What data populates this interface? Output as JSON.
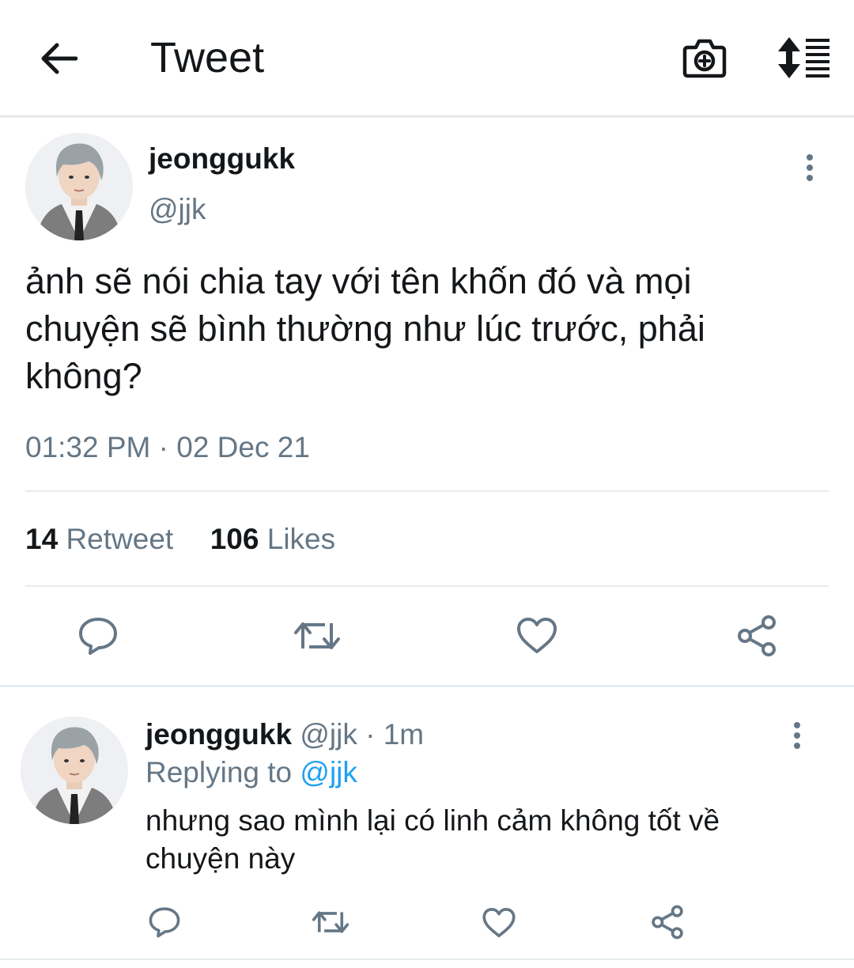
{
  "header": {
    "title": "Tweet",
    "back_icon": "arrow-left-icon",
    "camera_icon": "camera-plus-icon",
    "sort_icon": "sort-lines-icon"
  },
  "tweet": {
    "display_name": "jeonggukk",
    "handle": "@jjk",
    "text": "ảnh sẽ nói chia tay với tên khốn đó và mọi chuyện sẽ bình thường như lúc trước, phải không?",
    "timestamp": "01:32 PM · 02 Dec 21",
    "retweet_count": "14",
    "retweet_label": "Retweet",
    "likes_count": "106",
    "likes_label": "Likes"
  },
  "reply": {
    "display_name": "jeonggukk",
    "handle": "@jjk",
    "time": "· 1m",
    "replying_prefix": "Replying to",
    "replying_to": "@jjk",
    "text": "nhưng sao mình lại có linh cảm không tốt về chuyện này"
  },
  "colors": {
    "text": "#14171a",
    "muted": "#657786",
    "accent": "#1da1f2",
    "divider": "#e6ecf0"
  }
}
